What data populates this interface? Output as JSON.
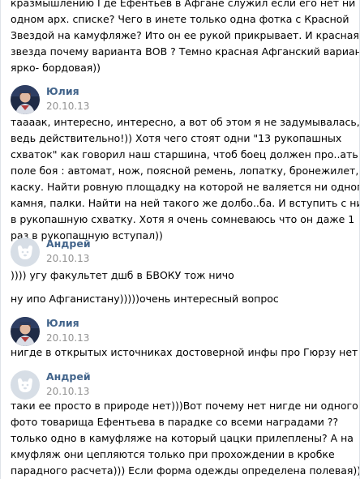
{
  "intro_text": {
    "lines": [
      "кразмышлению Где Ефентьев в Афгане служил если его нет ни в",
      "одном арх. списке? Чего в инете только одна фотка с Красной",
      "Звездой на камуфляже? Ито он ее рукой прикрывает. И красная",
      "звезда почему варианта ВОВ ? Темно красная Афганский вариант",
      "ярко- бордовая))"
    ]
  },
  "comments": [
    {
      "author": "Юлия",
      "date": "20.10.13",
      "avatar_icon": "user-photo-avatar",
      "lines": [
        "таааак, интересно, интересно, а вот об этом я не задумывалась, а",
        "ведь действительно!)) Хотя чего стоят одни \"13 рукопашных",
        "схваток\" как говорил наш старшина, чтоб боец должен про..ать на",
        "поле боя : автомат, нож, поясной ремень, лопатку, бронежилет,",
        "каску. Найти ровную площадку на которой не валяется ни одного",
        "камня, палки. Найти на ней такого же долбо..ба. И вступить с ним",
        "в рукопашную схватку. Хотя я очень сомневаюсь что он даже 1",
        "раз в рукопашную вступал))"
      ]
    },
    {
      "author": "Андрей",
      "date": "20.10.13",
      "avatar_icon": "default-dog-avatar",
      "lines": [
        ")))) угу факультет дшб в БВОКУ тож ничо"
      ],
      "extra_lines": [
        "ну ипо Афганистану)))))очень интересный вопрос"
      ]
    },
    {
      "author": "Юлия",
      "date": "20.10.13",
      "avatar_icon": "user-photo-avatar",
      "lines": [
        "нигде в открытых источниках достоверной инфы про Гюрзу нет"
      ]
    },
    {
      "author": "Андрей",
      "date": "20.10.13",
      "avatar_icon": "default-dog-avatar",
      "lines": [
        "таки ее просто в природе нет)))Вот почему нет нигде ни одного",
        "фото товарища Ефентьева в парадке со всеми наградами ??",
        "только одно в камуфляже на который цацки прилеплены? А на",
        "кмуфляж они цепляются только при прохождении в кробке",
        "парадного расчета))) Если форма одежды определена полевая))"
      ]
    }
  ],
  "colors": {
    "author_name": "#42648b",
    "date": "#939393",
    "text": "#000000",
    "default_avatar_bg": "#d7dee6"
  }
}
